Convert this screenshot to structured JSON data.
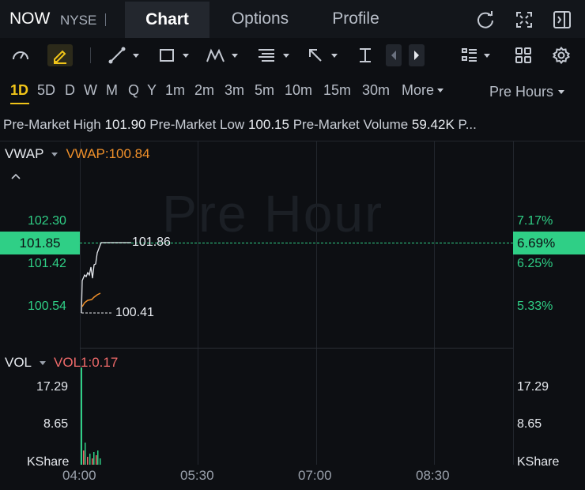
{
  "header": {
    "symbol": "NOW",
    "exchange": "NYSE",
    "tabs": [
      {
        "label": "Chart",
        "active": true
      },
      {
        "label": "Options",
        "active": false
      },
      {
        "label": "Profile",
        "active": false
      }
    ],
    "icons": [
      "refresh-icon",
      "expand-icon",
      "collapse-panel-icon"
    ]
  },
  "toolbar": {
    "icons": [
      "gauge-icon",
      "pen-icon",
      "line-tool-icon",
      "rectangle-tool-icon",
      "pattern-tool-icon",
      "fib-tool-icon",
      "arrow-tool-icon",
      "vertical-line-icon",
      "prev-icon",
      "next-icon",
      "layout-list-icon",
      "grid-icon",
      "settings-icon"
    ]
  },
  "periods": {
    "items": [
      "1D",
      "5D",
      "D",
      "W",
      "M",
      "Q",
      "Y",
      "1m",
      "2m",
      "3m",
      "5m",
      "10m",
      "15m",
      "30m"
    ],
    "active": "1D",
    "more_label": "More",
    "session_label": "Pre Hours"
  },
  "info": {
    "high_label": "Pre-Market High",
    "high_value": "101.90",
    "low_label": "Pre-Market Low",
    "low_value": "100.15",
    "volume_label": "Pre-Market Volume",
    "volume_value": "59.42K",
    "trunc": "P..."
  },
  "price_panel": {
    "indicator_name": "VWAP",
    "indicator_value": "VWAP:100.84",
    "watermark": "Pre Hour",
    "left_ticks": [
      "102.30",
      "101.42",
      "100.54"
    ],
    "right_ticks": [
      "7.17%",
      "6.25%",
      "5.33%"
    ],
    "current_price": "101.85",
    "current_pct": "6.69%",
    "high_marker": "101.86",
    "low_marker": "100.41"
  },
  "volume_panel": {
    "indicator_name": "VOL",
    "indicator_value": "VOL1:0.17",
    "left_ticks": [
      "17.29",
      "8.65"
    ],
    "right_ticks": [
      "17.29",
      "8.65"
    ],
    "unit_left": "KShare",
    "unit_right": "KShare"
  },
  "time_axis": [
    "04:00",
    "05:30",
    "07:00",
    "08:30"
  ],
  "colors": {
    "accent": "#f0c419",
    "up": "#2fcf86",
    "vwap": "#f0902a",
    "vol_label": "#ef6a6a"
  }
}
